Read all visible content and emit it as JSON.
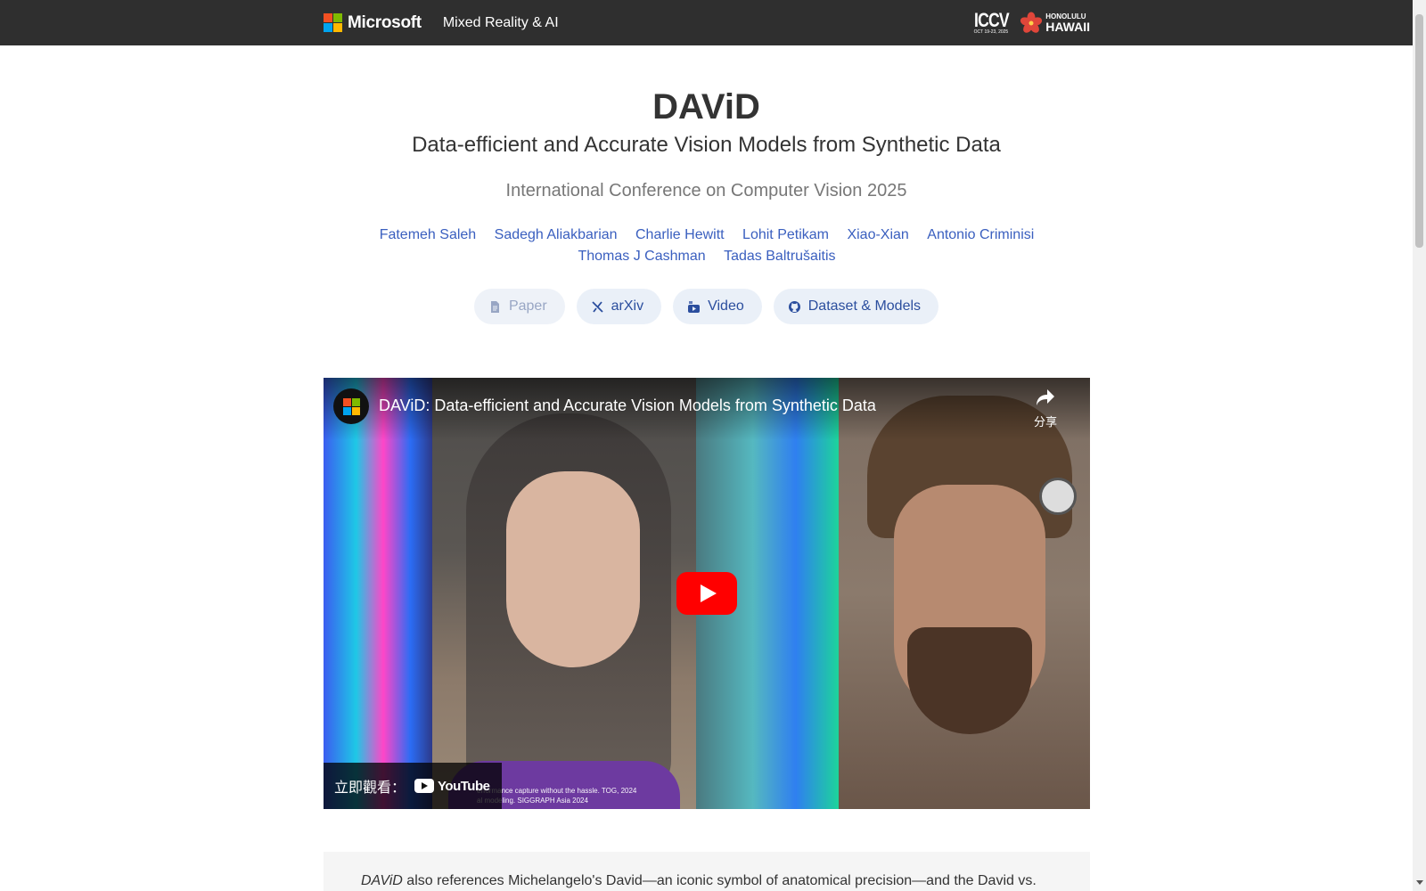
{
  "header": {
    "brand": "Microsoft",
    "section": "Mixed Reality & AI",
    "ms_colors": [
      "#f25022",
      "#7fba00",
      "#00a4ef",
      "#ffb900"
    ],
    "conf_logo": {
      "name": "ICCV",
      "dates": "OCT 19-23, 2025",
      "place_top": "HONOLULU",
      "place_bottom": "HAWAII",
      "flower_color": "#e0463a"
    }
  },
  "page": {
    "title": "DAViD",
    "subtitle": "Data-efficient and Accurate Vision Models from Synthetic Data",
    "conference": "International Conference on Computer Vision 2025"
  },
  "authors": [
    "Fatemeh Saleh",
    "Sadegh Aliakbarian",
    "Charlie Hewitt",
    "Lohit Petikam",
    "Xiao-Xian",
    "Antonio Criminisi",
    "Thomas J Cashman",
    "Tadas Baltrušaitis"
  ],
  "buttons": {
    "paper": {
      "label": "Paper",
      "icon": "document-icon",
      "disabled": true
    },
    "arxiv": {
      "label": "arXiv",
      "icon": "arxiv-icon"
    },
    "video": {
      "label": "Video",
      "icon": "youtube-icon"
    },
    "dataset": {
      "label": "Dataset & Models",
      "icon": "github-icon"
    }
  },
  "video": {
    "title": "DAViD: Data-efficient and Accurate Vision Models from Synthetic Data",
    "share_label": "分享",
    "watch_on": "立即觀看：",
    "youtube": "YouTube",
    "caption_line1": "erformance capture without the hassle. TOG, 2024",
    "caption_line2": "al modeling. SIGGRAPH Asia 2024"
  },
  "abstract": {
    "emphasis": "DAViD",
    "text": " also references Michelangelo's David—an iconic symbol of anatomical precision—and the David vs."
  }
}
